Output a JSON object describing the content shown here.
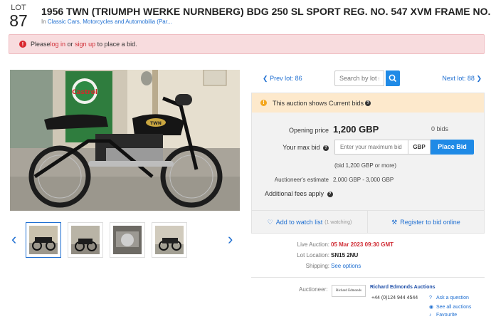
{
  "lot": {
    "label": "LOT",
    "number": "87"
  },
  "title": "1956 TWN (TRIUMPH WERKE NURNBERG) BDG 250 SL SPORT REG. NO. 547 XVM FRAME NO.",
  "category": {
    "prefix": "In ",
    "link": "Classic Cars, Motorcycles and Automobilia (Par..."
  },
  "alert": {
    "before": "Please ",
    "login": "log in",
    "middle": " or ",
    "signup": "sign up",
    "after": " to place a bid."
  },
  "nav": {
    "prev_label": "Prev lot: 86",
    "search_placeholder": "Search by lot #",
    "next_label": "Next lot: 88"
  },
  "notice": {
    "text": "This auction shows Current bids"
  },
  "bidding": {
    "opening_label": "Opening price",
    "opening_value": "1,200 GBP",
    "bids_count": "0 bids",
    "max_bid_label": "Your max bid",
    "max_bid_placeholder": "Enter your maximum bid",
    "currency": "GBP",
    "place_bid": "Place Bid",
    "bid_hint": "(bid 1,200 GBP or more)",
    "estimate_label": "Auctioneer's estimate",
    "estimate_value": "2,000 GBP - 3,000 GBP",
    "fees_label": "Additional fees apply"
  },
  "actions": {
    "watch_label": "Add to watch list",
    "watch_count": "(1 watching)",
    "register_label": "Register to bid online"
  },
  "details": {
    "live_auction_label": "Live Auction:",
    "live_auction_value": "05 Mar 2023 09:30 GMT",
    "location_label": "Lot Location:",
    "location_value": "SN15 2NU",
    "shipping_label": "Shipping:",
    "shipping_value": "See options"
  },
  "auctioneer": {
    "label": "Auctioneer:",
    "logo_text": "Richard Edmonds",
    "name": "Richard Edmonds Auctions",
    "phone": "+44 (0)124 944 4544",
    "ask_question": "Ask a question",
    "see_all": "See all auctions",
    "favourite": "Favourite"
  },
  "photo": {
    "sign_text": "Castrol",
    "tank_badge": "TWN"
  },
  "colors": {
    "accent": "#1f8ae6",
    "link": "#1f6fd1",
    "alert_bg": "#f8dcde",
    "notice_bg": "#fde9cc",
    "danger": "#d02d35"
  }
}
